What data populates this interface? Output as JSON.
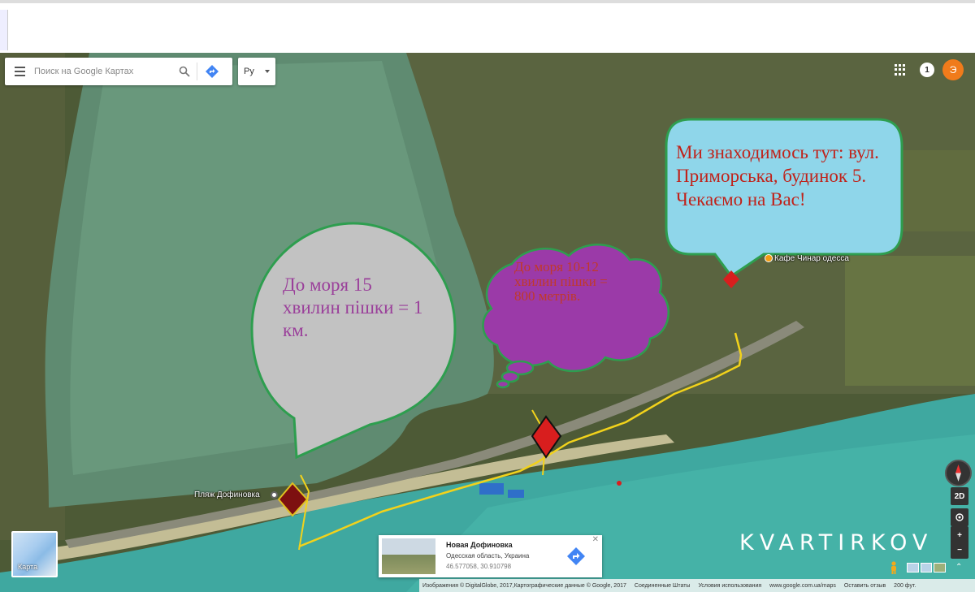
{
  "search": {
    "placeholder": "Поиск на Google Картах"
  },
  "language": {
    "selected": "Ру"
  },
  "header": {
    "notifications_count": "1",
    "avatar_letter": "Э"
  },
  "callouts": {
    "sea_15": "До моря 15 хвилин пішки = 1 км.",
    "sea_10": "До моря 10-12 хвилин пішки = 800 метрів.",
    "location": "Ми знаходимось тут: вул. Приморська, будинок 5. Чекаємо на Вас!"
  },
  "places": {
    "cafe": "Кафе Чинар одесса",
    "beach": "Пляж Дофиновка"
  },
  "watermark": "KVARTIRKOV",
  "map_switch": {
    "label": "Карта"
  },
  "place_card": {
    "title": "Новая Дофиновка",
    "region": "Одесская область, Украина",
    "coords": "46.577058, 30.910798"
  },
  "controls": {
    "view_2d": "2D"
  },
  "footer": {
    "attribution": "Изображения © DigitalGlobe, 2017,Картографические данные © Google, 2017",
    "country": "Соединенные Штаты",
    "terms": "Условия использования",
    "url": "www.google.com.ua/maps",
    "feedback": "Оставить отзыв",
    "scale": "200 фут."
  },
  "colors": {
    "callout_border": "#2e9e4f",
    "location_bubble": "#8fd6ea",
    "sea_15_bubble": "#c2c2c2",
    "sea_10_cloud": "#9b3aa8",
    "route": "#f2d21b",
    "marker": "#d81e1e"
  }
}
